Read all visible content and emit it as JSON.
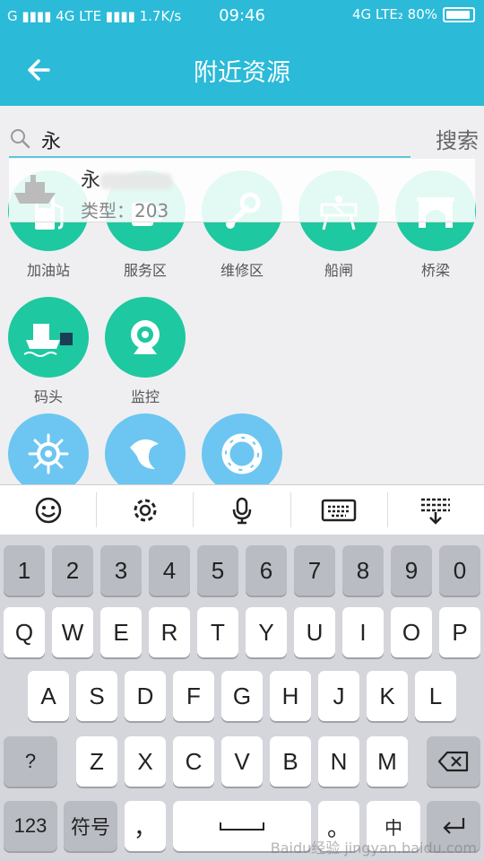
{
  "status_bar": {
    "left": "G ▮▮▮▮ 4G LTE ▮▮▮▮ 1.7K/s",
    "time": "09:46",
    "right": "4G LTE₂ 80%"
  },
  "header": {
    "title": "附近资源"
  },
  "search": {
    "value": "永",
    "button": "搜索"
  },
  "suggestion": {
    "name": "永",
    "type": "类型：203"
  },
  "categories": [
    {
      "label": "加油站",
      "icon": "gas-station-icon",
      "color": "#1ec8a0"
    },
    {
      "label": "服务区",
      "icon": "cup-icon",
      "color": "#1ec8a0"
    },
    {
      "label": "维修区",
      "icon": "wrench-icon",
      "color": "#1ec8a0"
    },
    {
      "label": "船闸",
      "icon": "lock-gate-icon",
      "color": "#1ec8a0"
    },
    {
      "label": "桥梁",
      "icon": "bridge-icon",
      "color": "#1ec8a0"
    },
    {
      "label": "码头",
      "icon": "dock-icon",
      "color": "#1ec8a0"
    },
    {
      "label": "监控",
      "icon": "camera-icon",
      "color": "#1ec8a0"
    },
    {
      "label": "",
      "icon": "helm-icon",
      "color": "#6cc6f1"
    },
    {
      "label": "",
      "icon": "dolphin-icon",
      "color": "#6cc6f1"
    },
    {
      "label": "",
      "icon": "lifebuoy-icon",
      "color": "#6cc6f1"
    }
  ],
  "keyboard": {
    "numbers": [
      "1",
      "2",
      "3",
      "4",
      "5",
      "6",
      "7",
      "8",
      "9",
      "0"
    ],
    "row1": [
      "Q",
      "W",
      "E",
      "R",
      "T",
      "Y",
      "U",
      "I",
      "O",
      "P"
    ],
    "row2": [
      "A",
      "S",
      "D",
      "F",
      "G",
      "H",
      "J",
      "K",
      "L"
    ],
    "row3": [
      "?",
      "Z",
      "X",
      "C",
      "V",
      "B",
      "N",
      "M"
    ],
    "bottom": {
      "k123": "123",
      "symbols": "符号",
      "comma": "，",
      "period": "。",
      "lang": "中"
    },
    "watermark": "Baidu经验 jingyan.baidu.com"
  }
}
